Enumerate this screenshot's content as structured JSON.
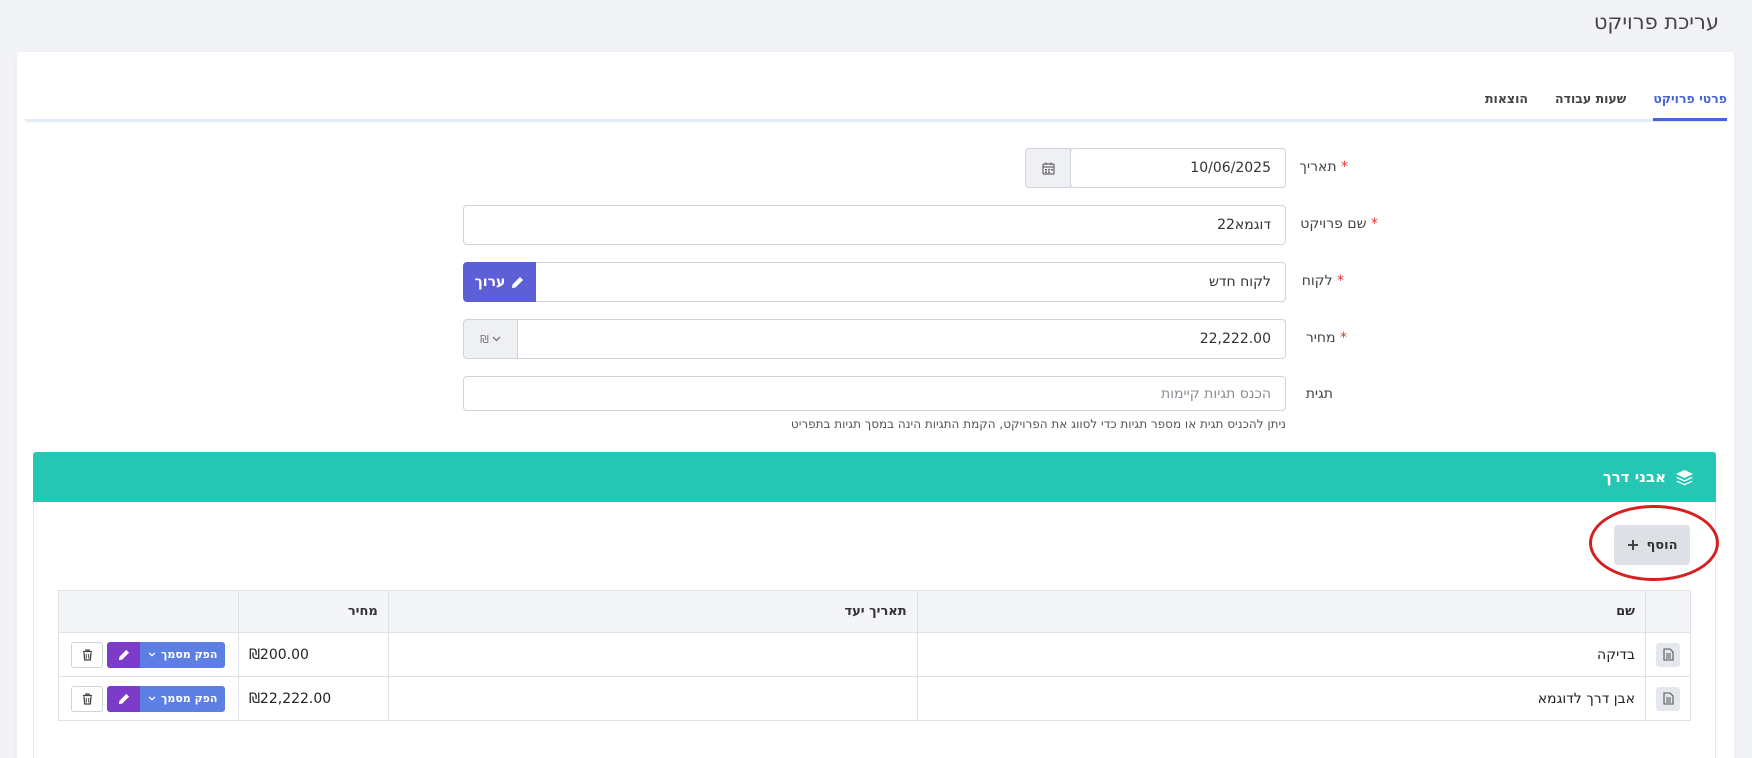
{
  "page": {
    "title": "עריכת פרויקט"
  },
  "tabs": [
    {
      "label": "פרטי פרויקט",
      "active": true
    },
    {
      "label": "שעות עבודה",
      "active": false
    },
    {
      "label": "הוצאות",
      "active": false
    }
  ],
  "form": {
    "date": {
      "label": "תאריך",
      "value": "10/06/2025",
      "icon": "calendar-icon"
    },
    "project_name": {
      "label": "שם פרויקט",
      "value": "דוגמא22"
    },
    "client": {
      "label": "לקוח",
      "value": "לקוח חדש",
      "edit_label": "ערוך"
    },
    "price": {
      "label": "מחיר",
      "value": "22,222.00",
      "currency": "₪"
    },
    "tag": {
      "label": "תגית",
      "placeholder": "הכנס תגיות קיימות",
      "helper": "ניתן להכניס תגית או מספר תגיות כדי לסווג את הפרויקט, הקמת התגיות הינה במסך תגיות בתפריט"
    },
    "required_mark": "*"
  },
  "milestones": {
    "title": "אבני דרך",
    "add_label": "הוסף",
    "columns": [
      "שם",
      "תאריך יעד",
      "מחיר"
    ],
    "rows": [
      {
        "name": "בדיקה",
        "due_date": "",
        "price": "₪200.00"
      },
      {
        "name": "אבן דרך לדוגמא",
        "due_date": "",
        "price": "₪22,222.00"
      }
    ],
    "doc_button_label": "הפק מסמך"
  },
  "colors": {
    "accent": "#4765d8",
    "teal": "#26c6b5",
    "purple": "#7c3cc9",
    "annotation": "#d42020"
  }
}
